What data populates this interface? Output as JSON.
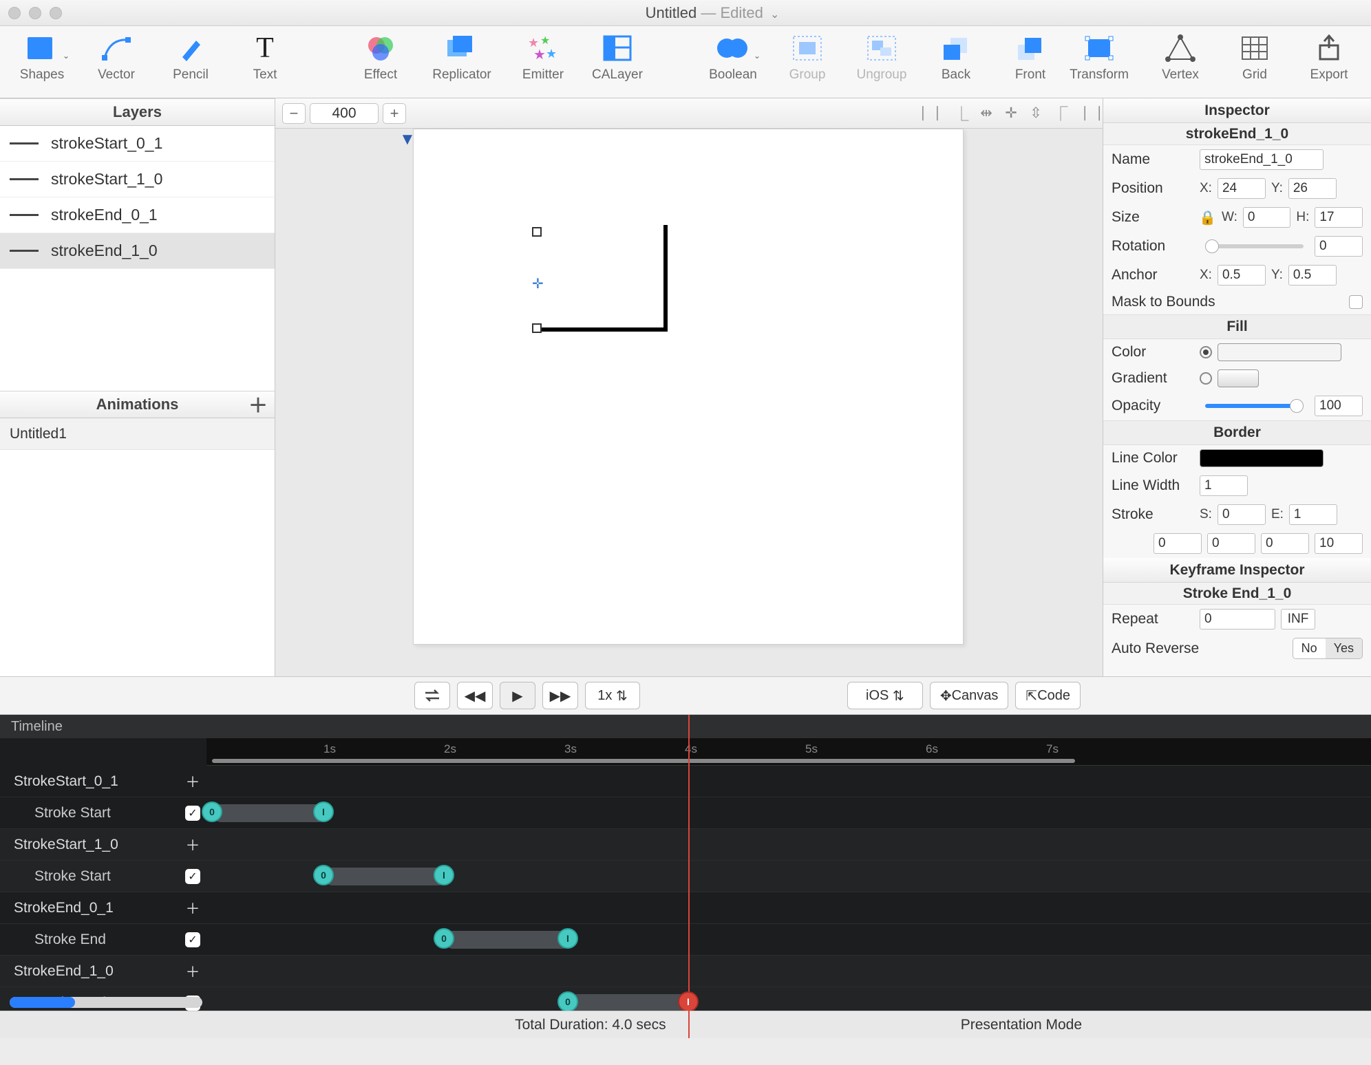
{
  "window": {
    "title": "Untitled",
    "status": "Edited"
  },
  "toolbar": {
    "shapes": "Shapes",
    "vector": "Vector",
    "pencil": "Pencil",
    "text": "Text",
    "effect": "Effect",
    "replicator": "Replicator",
    "emitter": "Emitter",
    "calayer": "CALayer",
    "boolean": "Boolean",
    "group": "Group",
    "ungroup": "Ungroup",
    "back": "Back",
    "front": "Front",
    "transform": "Transform",
    "vertex": "Vertex",
    "grid": "Grid",
    "export": "Export"
  },
  "leftPanel": {
    "layersTitle": "Layers",
    "layers": [
      "strokeStart_0_1",
      "strokeStart_1_0",
      "strokeEnd_0_1",
      "strokeEnd_1_0"
    ],
    "selectedLayerIndex": 3,
    "animationsTitle": "Animations",
    "animations": [
      "Untitled1"
    ]
  },
  "canvas": {
    "zoom": "400"
  },
  "inspector": {
    "title": "Inspector",
    "subtitle": "strokeEnd_1_0",
    "nameLabel": "Name",
    "nameValue": "strokeEnd_1_0",
    "positionLabel": "Position",
    "posX": "24",
    "posY": "26",
    "sizeLabel": "Size",
    "sizeW": "0",
    "sizeH": "17",
    "rotationLabel": "Rotation",
    "rotationValue": "0",
    "anchorLabel": "Anchor",
    "anchorX": "0.5",
    "anchorY": "0.5",
    "maskLabel": "Mask to Bounds",
    "fillHeader": "Fill",
    "colorLabel": "Color",
    "gradientLabel": "Gradient",
    "opacityLabel": "Opacity",
    "opacityValue": "100",
    "borderHeader": "Border",
    "lineColorLabel": "Line Color",
    "lineWidthLabel": "Line Width",
    "lineWidthValue": "1",
    "strokeLabel": "Stroke",
    "strokeS": "0",
    "strokeE": "1",
    "pad": [
      "0",
      "0",
      "0",
      "10"
    ]
  },
  "playback": {
    "speed": "1x",
    "platform": "iOS",
    "canvasBtn": "Canvas",
    "codeBtn": "Code"
  },
  "timeline": {
    "header": "Timeline",
    "seconds": [
      "1s",
      "2s",
      "3s",
      "4s",
      "5s",
      "6s",
      "7s"
    ],
    "tracks": [
      {
        "name": "StrokeStart_0_1",
        "sub": "Stroke Start",
        "clipStart": 8,
        "clipEnd": 175,
        "kfs": [
          8,
          170
        ]
      },
      {
        "name": "StrokeStart_1_0",
        "sub": "Stroke Start",
        "clipStart": 170,
        "clipEnd": 350,
        "kfs": [
          170,
          345
        ]
      },
      {
        "name": "StrokeEnd_0_1",
        "sub": "Stroke End",
        "clipStart": 345,
        "clipEnd": 530,
        "kfs": [
          345,
          525
        ]
      },
      {
        "name": "StrokeEnd_1_0",
        "sub": "Stroke End",
        "clipStart": 525,
        "clipEnd": 710,
        "kfs": [
          525,
          700
        ],
        "lastRed": true
      }
    ],
    "footerDuration": "Total Duration: 4.0 secs",
    "footerMode": "Presentation Mode"
  },
  "keyframeInspector": {
    "title": "Keyframe Inspector",
    "subtitle": "Stroke End_1_0",
    "repeatLabel": "Repeat",
    "repeatValue": "0",
    "infLabel": "INF",
    "autoReverseLabel": "Auto Reverse",
    "noLabel": "No",
    "yesLabel": "Yes"
  }
}
